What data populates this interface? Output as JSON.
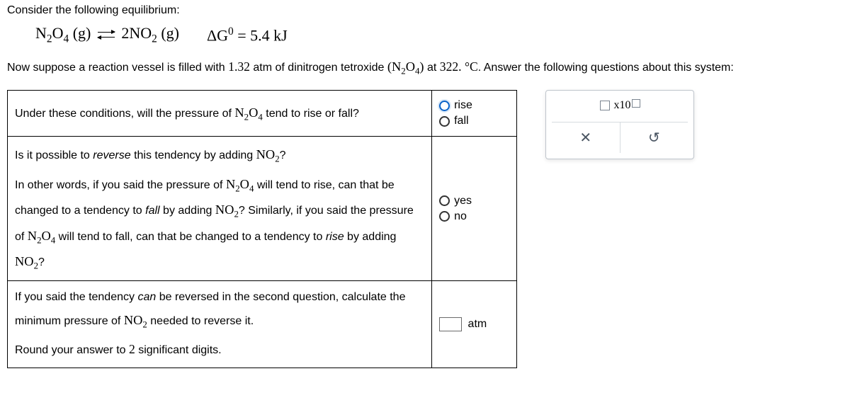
{
  "intro": "Consider the following equilibrium:",
  "equation": {
    "lhs": "N<sub>2</sub>O<sub>4</sub> (g)",
    "rhs": "2NO<sub>2</sub> (g)",
    "dg": "ΔG<sup>0</sup> = 5.4 kJ"
  },
  "setup_html": "Now suppose a reaction vessel is filled with <span class='mathnum'>1.32</span> atm of dinitrogen tetroxide <span class='chem'>(N<sub>2</sub>O<sub>4</sub>)</span> at <span class='mathnum'>322. °C</span>. Answer the following questions about this system:",
  "q1": {
    "text_html": "Under these conditions, will the pressure of <span class='chem'>N<sub>2</sub>O<sub>4</sub></span> tend to rise or fall?",
    "opt_rise": "rise",
    "opt_fall": "fall"
  },
  "q2": {
    "line1_html": "Is it possible to <em class='it'>reverse</em> this tendency by adding <span class='chem'>NO<sub>2</sub></span>?",
    "line2_html": "In other words, if you said the pressure of <span class='chem'>N<sub>2</sub>O<sub>4</sub></span> will tend to rise, can that be changed to a tendency to <em class='it'>fall</em> by adding <span class='chem'>NO<sub>2</sub></span>? Similarly, if you said the pressure of <span class='chem'>N<sub>2</sub>O<sub>4</sub></span> will tend to fall, can that be changed to a tendency to <em class='it'>rise</em> by adding <span class='chem'>NO<sub>2</sub></span>?",
    "opt_yes": "yes",
    "opt_no": "no"
  },
  "q3": {
    "text_html": "If you said the tendency <em class='it'>can</em> be reversed in the second question, calculate the minimum pressure of <span class='chem'>NO<sub>2</sub></span> needed to reverse it.",
    "hint_html": "Round your answer to <span class='mathnum'>2</span> significant digits.",
    "unit": "atm"
  },
  "tools": {
    "x10_label": "x10",
    "close_glyph": "✕",
    "undo_glyph": "↻"
  }
}
